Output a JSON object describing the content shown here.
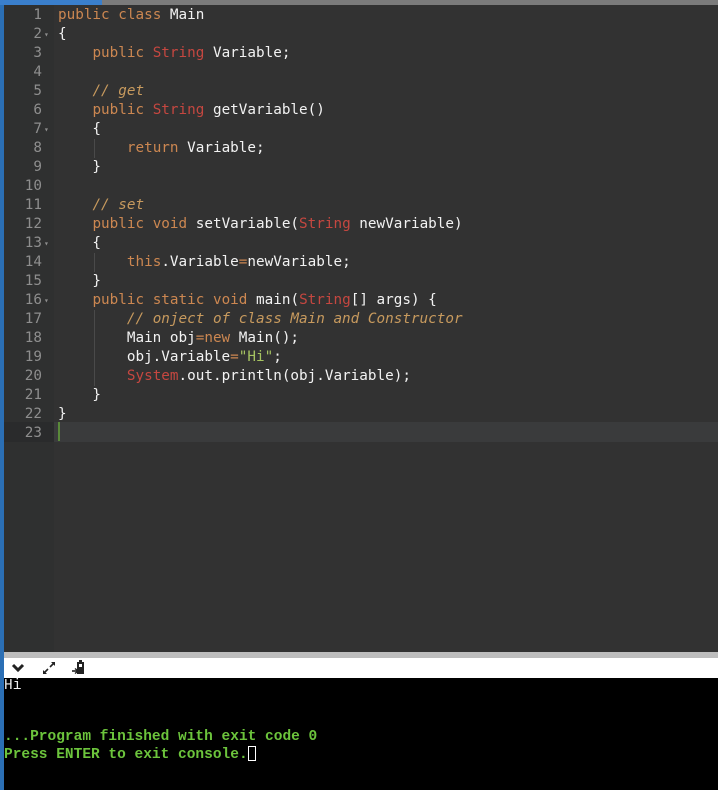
{
  "editor": {
    "language": "java",
    "active_line": 23,
    "lines": [
      {
        "n": "1",
        "fold": false,
        "tokens": [
          [
            "kw",
            "public"
          ],
          [
            "",
            "",
            " "
          ],
          [
            "kw",
            "class"
          ],
          [
            "",
            " Main"
          ]
        ]
      },
      {
        "n": "2",
        "fold": true,
        "tokens": [
          [
            "",
            "{"
          ]
        ]
      },
      {
        "n": "3",
        "fold": false,
        "tokens": [
          [
            "",
            "    "
          ],
          [
            "kw",
            "public"
          ],
          [
            "",
            " "
          ],
          [
            "ty",
            "String"
          ],
          [
            "",
            " Variable;"
          ]
        ]
      },
      {
        "n": "4",
        "fold": false,
        "tokens": []
      },
      {
        "n": "5",
        "fold": false,
        "tokens": [
          [
            "",
            "    "
          ],
          [
            "cm",
            "// get"
          ]
        ]
      },
      {
        "n": "6",
        "fold": false,
        "tokens": [
          [
            "",
            "    "
          ],
          [
            "kw",
            "public"
          ],
          [
            "",
            " "
          ],
          [
            "ty",
            "String"
          ],
          [
            "",
            " getVariable()"
          ]
        ]
      },
      {
        "n": "7",
        "fold": true,
        "tokens": [
          [
            "",
            "    {"
          ]
        ]
      },
      {
        "n": "8",
        "fold": false,
        "tokens": [
          [
            "",
            "        "
          ],
          [
            "kw",
            "return"
          ],
          [
            "",
            " Variable;"
          ]
        ]
      },
      {
        "n": "9",
        "fold": false,
        "tokens": [
          [
            "",
            "    }"
          ]
        ]
      },
      {
        "n": "10",
        "fold": false,
        "tokens": []
      },
      {
        "n": "11",
        "fold": false,
        "tokens": [
          [
            "",
            "    "
          ],
          [
            "cm",
            "// set"
          ]
        ]
      },
      {
        "n": "12",
        "fold": false,
        "tokens": [
          [
            "",
            "    "
          ],
          [
            "kw",
            "public"
          ],
          [
            "",
            " "
          ],
          [
            "kw",
            "void"
          ],
          [
            "",
            " setVariable("
          ],
          [
            "ty",
            "String"
          ],
          [
            "",
            " newVariable)"
          ]
        ]
      },
      {
        "n": "13",
        "fold": true,
        "tokens": [
          [
            "",
            "    {"
          ]
        ]
      },
      {
        "n": "14",
        "fold": false,
        "tokens": [
          [
            "",
            "        "
          ],
          [
            "kw",
            "this"
          ],
          [
            "",
            ".Variable"
          ],
          [
            "op",
            "="
          ],
          [
            "",
            "newVariable;"
          ]
        ]
      },
      {
        "n": "15",
        "fold": false,
        "tokens": [
          [
            "",
            "    }"
          ]
        ]
      },
      {
        "n": "16",
        "fold": true,
        "tokens": [
          [
            "",
            "    "
          ],
          [
            "kw",
            "public"
          ],
          [
            "",
            " "
          ],
          [
            "kw",
            "static"
          ],
          [
            "",
            " "
          ],
          [
            "kw",
            "void"
          ],
          [
            "",
            " main("
          ],
          [
            "ty",
            "String"
          ],
          [
            "",
            "[] args) {"
          ]
        ]
      },
      {
        "n": "17",
        "fold": false,
        "tokens": [
          [
            "",
            "        "
          ],
          [
            "cm",
            "// onject of class Main and Constructor"
          ]
        ]
      },
      {
        "n": "18",
        "fold": false,
        "tokens": [
          [
            "",
            "        Main obj"
          ],
          [
            "op",
            "="
          ],
          [
            "kw",
            "new"
          ],
          [
            "",
            " Main();"
          ]
        ]
      },
      {
        "n": "19",
        "fold": false,
        "tokens": [
          [
            "",
            "        obj.Variable"
          ],
          [
            "op",
            "="
          ],
          [
            "st",
            "\"Hi\""
          ],
          [
            "",
            ";"
          ]
        ]
      },
      {
        "n": "20",
        "fold": false,
        "tokens": [
          [
            "",
            "        "
          ],
          [
            "ty",
            "System"
          ],
          [
            "",
            ".out.println(obj.Variable);"
          ]
        ]
      },
      {
        "n": "21",
        "fold": false,
        "tokens": [
          [
            "",
            "    }"
          ]
        ]
      },
      {
        "n": "22",
        "fold": false,
        "tokens": [
          [
            "",
            "}"
          ]
        ]
      },
      {
        "n": "23",
        "fold": false,
        "tokens": []
      }
    ]
  },
  "console_toolbar": {
    "icons": [
      "chevron-down-icon",
      "expand-icon",
      "stdin-icon"
    ]
  },
  "console": {
    "output": "Hi",
    "finished_message": "...Program finished with exit code 0",
    "exit_prompt": "Press ENTER to exit console."
  },
  "colors": {
    "keyword": "#cc8751",
    "type": "#c54740",
    "comment": "#c79a5e",
    "string": "#a5c261",
    "console_green": "#6cc43c"
  }
}
